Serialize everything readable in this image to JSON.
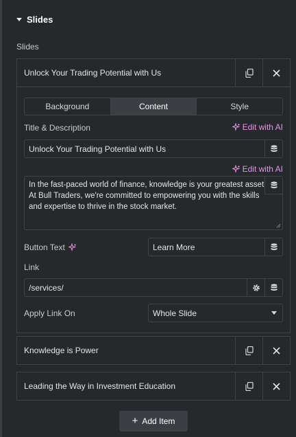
{
  "section": {
    "title": "Slides",
    "icon": "caret-down-icon"
  },
  "slides_label": "Slides",
  "slides": [
    {
      "title": "Unlock Your Trading Potential with Us",
      "expanded": true
    },
    {
      "title": "Knowledge is Power",
      "expanded": false
    },
    {
      "title": "Leading the Way in Investment Education",
      "expanded": false
    }
  ],
  "editor": {
    "tabs": [
      {
        "label": "Background",
        "active": false
      },
      {
        "label": "Content",
        "active": true
      },
      {
        "label": "Style",
        "active": false
      }
    ],
    "title_desc_label": "Title & Description",
    "edit_with_ai": "Edit with AI",
    "title_value": "Unlock Your Trading Potential with Us",
    "description_value": "In the fast-paced world of finance, knowledge is your greatest asset.\nAt Bull Traders, we're committed to empowering you with the skills\nand expertise to thrive in the stock market.",
    "button_text_label": "Button Text",
    "button_text_value": "Learn More",
    "link_label": "Link",
    "link_value": "/services/",
    "apply_link_label": "Apply Link On",
    "apply_link_value": "Whole Slide"
  },
  "add_item_label": "Add Item",
  "colors": {
    "accent_ai": "#e793ea",
    "panel_bg": "#26292c",
    "border": "#3f4347",
    "active_tab": "#3b3f44"
  },
  "icons": [
    "caret-down-icon",
    "duplicate-icon",
    "close-icon",
    "sparkle-icon",
    "database-icon",
    "gear-icon",
    "chevron-down-icon",
    "plus-icon"
  ]
}
